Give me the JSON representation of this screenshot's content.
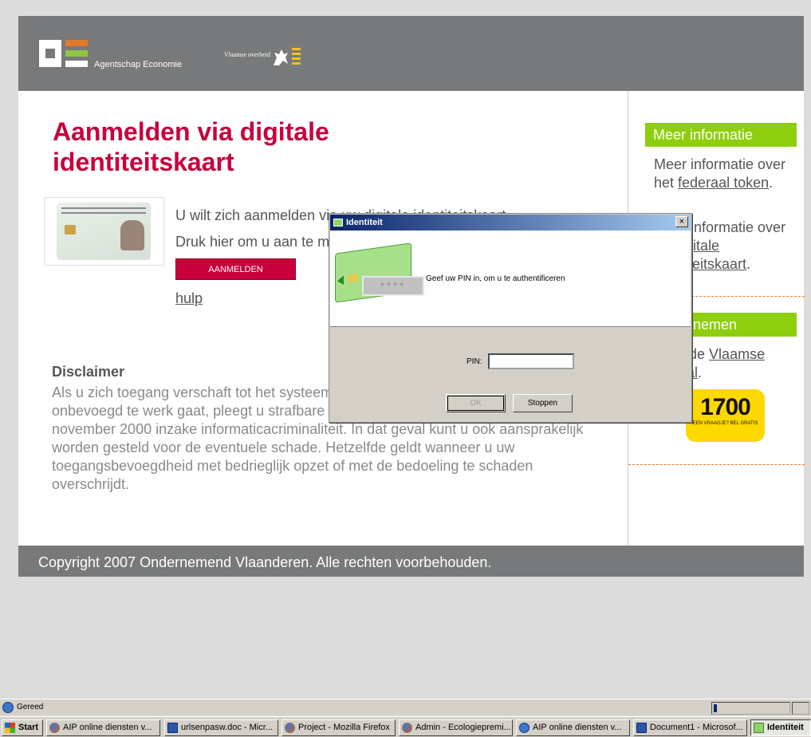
{
  "header": {
    "logo_text": "Agentschap Economie",
    "vlaanderen_text": "Vlaamse overheid"
  },
  "main": {
    "title": "Aanmelden via digitale identiteitskaart",
    "intro_line1_prefix": "U wilt zich aanmelden via uw ",
    "intro_line1_link": "digitale identiteitskaart",
    "intro_line2": "Druk hier om u aan te melden.",
    "login_button": "AANMELDEN",
    "help_link": "hulp",
    "disclaimer_heading": "Disclaimer",
    "disclaimer_text": "Als u zich toegang verschaft tot het systeem, hoewel u daartoe niet gerechtigd of onbevoegd te werk gaat, pleegt u strafbare feiten overeenkomstig de wet van 28 november 2000 inzake informaticacriminaliteit. In dat geval kunt u ook aansprakelijk worden gesteld voor de eventuele schade. Hetzelfde geldt wanneer u uw toegangsbevoegdheid met bedrieglijk opzet of met de bedoeling te schaden overschrijdt."
  },
  "sidebar": {
    "heading_info": "Meer informatie",
    "info1_prefix": "Meer informatie over het ",
    "info1_link": "federaal token",
    "info2_prefix": "Meer informatie over de ",
    "info2_link": "digitale identiteitskaart",
    "heading_ondernemen": "Ondernemen",
    "ondernemen_prefix": "Naar de ",
    "ondernemen_link": "Vlaamse portaal",
    "hotline_number": "1700",
    "hotline_sub": "EEN VRAAGJE? BEL GRATIS"
  },
  "footer": {
    "copyright": "Copyright 2007 Ondernemend Vlaanderen. Alle rechten voorbehouden."
  },
  "dialog": {
    "title": "Identiteit",
    "close": "×",
    "pin_mask": "****",
    "message": "Geef uw PIN in, om u te authentificeren",
    "pin_label": "PIN:",
    "pin_value": "",
    "ok_button": "OK",
    "cancel_button": "Stoppen"
  },
  "statusbar": {
    "text": "Gereed"
  },
  "taskbar": {
    "start": "Start",
    "tasks": [
      {
        "label": "AIP online diensten v..."
      },
      {
        "label": "urlsenpasw.doc - Micr..."
      },
      {
        "label": "Project - Mozilla Firefox"
      },
      {
        "label": "Admin - Ecologiepremi..."
      },
      {
        "label": "AIP online diensten v..."
      },
      {
        "label": "Document1 - Microsof..."
      },
      {
        "label": "Identiteit"
      }
    ]
  }
}
